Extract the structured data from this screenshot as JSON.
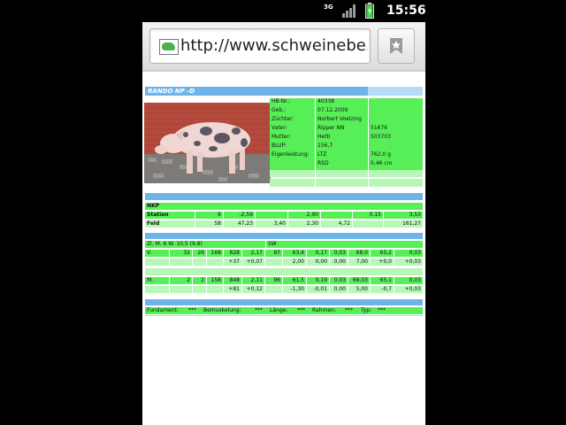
{
  "status": {
    "network": "3G",
    "time": "15:56"
  },
  "browser": {
    "url": "http://www.schweinebe..."
  },
  "animal": {
    "title": "RANDO NP -D",
    "info": [
      {
        "label": "HB-Nr.:",
        "value": "40338",
        "extra": ""
      },
      {
        "label": "Geb.:",
        "value": "07.12.2009",
        "extra": ""
      },
      {
        "label": "Züchter:",
        "value": "Norbert Voelzing",
        "extra": ""
      },
      {
        "label": "Vater:",
        "value": "Ripper NN",
        "extra": "51676"
      },
      {
        "label": "Mutter:",
        "value": "Hetti",
        "extra": "503703"
      },
      {
        "label": "BLUP:",
        "value": "156,7",
        "extra": ""
      },
      {
        "label": "Eigenleistung:",
        "value": "LTZ",
        "extra": "762,0 g"
      },
      {
        "label": "",
        "value": "RSD",
        "extra": "0,46 cm"
      }
    ]
  },
  "nkp": {
    "header": "NKP",
    "rows": [
      {
        "label": "Station",
        "cells": [
          "6",
          "-2,59",
          "",
          "2,90",
          "",
          "0,15",
          "3,53"
        ]
      },
      {
        "label": "Feld",
        "cells": [
          "58",
          "47,23",
          "3,40",
          "2,30",
          "4,72",
          "",
          "161,27"
        ]
      }
    ]
  },
  "litter": {
    "header_left": "Zl. M. 6 W. 10,5 (9,8)",
    "header_right": "SW",
    "rows": [
      [
        "V.",
        "32",
        "26",
        "168",
        "828",
        "2,17",
        "97",
        "63,4",
        "0,17",
        "0,03",
        "68,0",
        "65,2",
        "0,03"
      ],
      [
        "",
        "",
        "",
        "",
        "+37",
        "+0,07",
        "",
        "2,00",
        "0,00",
        "0,00",
        "7,00",
        "+0,0",
        "+0,03"
      ],
      [
        "M.",
        "2",
        "2",
        "158",
        "848",
        "2,11",
        "96",
        "61,5",
        "0,19",
        "0,03",
        "68,03",
        "65,1",
        "0,03"
      ],
      [
        "",
        "",
        "",
        "",
        "+81",
        "+0,12",
        "",
        "-1,30",
        "-0,01",
        "0,00",
        "5,00",
        "-0,7",
        "+0,03"
      ]
    ]
  },
  "ratings": [
    {
      "label": "Fundament:",
      "value": "***"
    },
    {
      "label": "Bemuskelung:",
      "value": "***"
    },
    {
      "label": "Länge:",
      "value": "***"
    },
    {
      "label": "Rahmen:",
      "value": "***"
    },
    {
      "label": "Typ:",
      "value": "***"
    }
  ]
}
